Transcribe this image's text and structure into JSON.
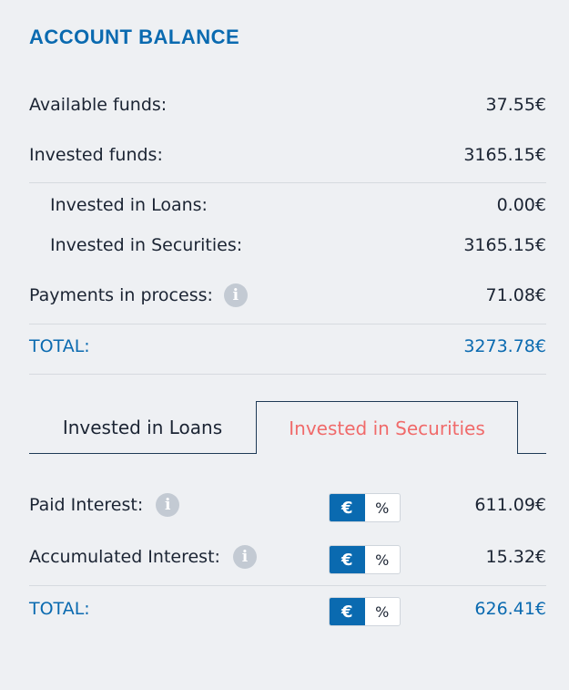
{
  "title": "ACCOUNT BALANCE",
  "balance": {
    "available_label": "Available funds:",
    "available_value": "37.55€",
    "invested_label": "Invested funds:",
    "invested_value": "3165.15€",
    "loans_label": "Invested in Loans:",
    "loans_value": "0.00€",
    "securities_label": "Invested in Securities:",
    "securities_value": "3165.15€",
    "payments_label": "Payments in process:",
    "payments_value": "71.08€",
    "total_label": "TOTAL:",
    "total_value": "3273.78€"
  },
  "tabs": {
    "loans": "Invested in Loans",
    "securities": "Invested in Securities",
    "active": "securities"
  },
  "interest": {
    "paid_label": "Paid Interest:",
    "paid_value": "611.09€",
    "accumulated_label": "Accumulated Interest:",
    "accumulated_value": "15.32€",
    "total_label": "TOTAL:",
    "total_value": "626.41€"
  },
  "toggle": {
    "euro": "€",
    "percent": "%",
    "selected": "euro"
  },
  "icons": {
    "info": "i"
  },
  "colors": {
    "accent": "#0a6ab0",
    "active_tab_text": "#f06a6a",
    "background": "#eef0f3"
  }
}
